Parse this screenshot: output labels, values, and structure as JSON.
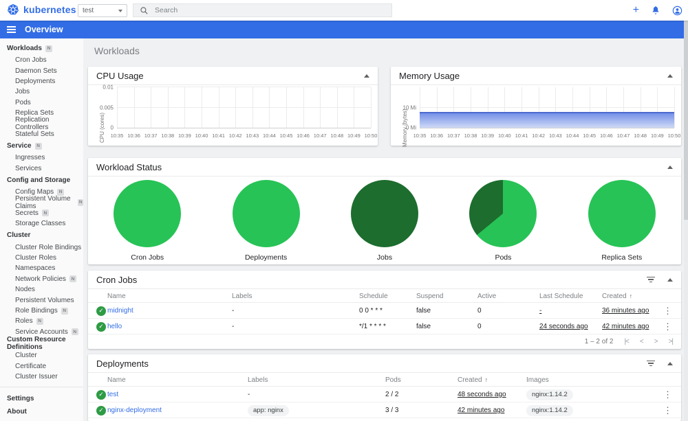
{
  "colors": {
    "accent": "#326de6",
    "pie_green_bright": "#27c356",
    "pie_green_dark": "#1d6d2e",
    "check_green": "#2e9b45",
    "memory_area_line": "#4b69cf"
  },
  "topbar": {
    "brand": "kubernetes",
    "namespace_selected": "test",
    "search_placeholder": "Search",
    "action_icons": [
      "plus-icon",
      "bell-icon",
      "account-icon"
    ]
  },
  "appbar": {
    "title": "Overview"
  },
  "sidebar": {
    "items": [
      {
        "label": "Workloads",
        "type": "group",
        "badge": "N"
      },
      {
        "label": "Cron Jobs",
        "type": "child"
      },
      {
        "label": "Daemon Sets",
        "type": "child"
      },
      {
        "label": "Deployments",
        "type": "child"
      },
      {
        "label": "Jobs",
        "type": "child"
      },
      {
        "label": "Pods",
        "type": "child"
      },
      {
        "label": "Replica Sets",
        "type": "child"
      },
      {
        "label": "Replication Controllers",
        "type": "child"
      },
      {
        "label": "Stateful Sets",
        "type": "child"
      },
      {
        "label": "Service",
        "type": "group",
        "badge": "N"
      },
      {
        "label": "Ingresses",
        "type": "child"
      },
      {
        "label": "Services",
        "type": "child"
      },
      {
        "label": "Config and Storage",
        "type": "section"
      },
      {
        "label": "Config Maps",
        "type": "child",
        "badge": "N"
      },
      {
        "label": "Persistent Volume Claims",
        "type": "child",
        "badge": "N"
      },
      {
        "label": "Secrets",
        "type": "child",
        "badge": "N"
      },
      {
        "label": "Storage Classes",
        "type": "child"
      },
      {
        "label": "Cluster",
        "type": "section"
      },
      {
        "label": "Cluster Role Bindings",
        "type": "child"
      },
      {
        "label": "Cluster Roles",
        "type": "child"
      },
      {
        "label": "Namespaces",
        "type": "child"
      },
      {
        "label": "Network Policies",
        "type": "child",
        "badge": "N"
      },
      {
        "label": "Nodes",
        "type": "child"
      },
      {
        "label": "Persistent Volumes",
        "type": "child"
      },
      {
        "label": "Role Bindings",
        "type": "child",
        "badge": "N"
      },
      {
        "label": "Roles",
        "type": "child",
        "badge": "N"
      },
      {
        "label": "Service Accounts",
        "type": "child",
        "badge": "N"
      },
      {
        "label": "Custom Resource Definitions",
        "type": "section"
      },
      {
        "label": "Cluster",
        "type": "child"
      },
      {
        "label": "Certificate",
        "type": "child"
      },
      {
        "label": "Cluster Issuer",
        "type": "child"
      },
      {
        "type": "divider"
      },
      {
        "label": "Settings",
        "type": "section"
      },
      {
        "label": "About",
        "type": "section"
      }
    ]
  },
  "page": {
    "title": "Workloads"
  },
  "chart_data": [
    {
      "id": "cpu",
      "type": "line",
      "title": "CPU Usage",
      "ylabel": "CPU (cores)",
      "x": [
        "10:35",
        "10:36",
        "10:37",
        "10:38",
        "10:39",
        "10:40",
        "10:41",
        "10:42",
        "10:43",
        "10:44",
        "10:45",
        "10:46",
        "10:47",
        "10:48",
        "10:49",
        "10:50"
      ],
      "series": [],
      "ylim": [
        0,
        0.01
      ],
      "yticks": [
        {
          "label": "0",
          "value": 0
        },
        {
          "label": "0.005",
          "value": 0.005
        },
        {
          "label": "0.01",
          "value": 0.01
        }
      ],
      "grid": true,
      "legend": false
    },
    {
      "id": "memory",
      "type": "area",
      "title": "Memory Usage",
      "ylabel": "Memory (bytes)",
      "x": [
        "10:35",
        "10:36",
        "10:37",
        "10:38",
        "10:39",
        "10:40",
        "10:41",
        "10:42",
        "10:43",
        "10:44",
        "10:45",
        "10:46",
        "10:47",
        "10:48",
        "10:49",
        "10:50"
      ],
      "series": [
        {
          "name": "memory",
          "values": [
            7.8,
            7.8,
            7.8,
            7.8,
            7.8,
            7.8,
            7.8,
            7.8,
            7.8,
            7.8,
            7.8,
            7.8,
            7.8,
            7.8,
            7.8,
            7.8
          ],
          "unit": "Mi"
        }
      ],
      "ylim": [
        0,
        20.3
      ],
      "yticks": [
        {
          "label": "0 Mi",
          "value": 0
        },
        {
          "label": "10 Mi",
          "value": 10
        }
      ],
      "grid": true,
      "legend": false
    },
    {
      "id": "workload-status",
      "type": "pie",
      "title": "Workload Status",
      "pies": [
        {
          "label": "Cron Jobs",
          "segments": [
            {
              "status": "running",
              "color": "#27c356",
              "pct": 100
            }
          ]
        },
        {
          "label": "Deployments",
          "segments": [
            {
              "status": "running",
              "color": "#27c356",
              "pct": 100
            }
          ]
        },
        {
          "label": "Jobs",
          "segments": [
            {
              "status": "succeeded",
              "color": "#1d6d2e",
              "pct": 100
            }
          ]
        },
        {
          "label": "Pods",
          "segments": [
            {
              "status": "running",
              "color": "#27c356",
              "pct": 64
            },
            {
              "status": "succeeded",
              "color": "#1d6d2e",
              "pct": 36
            }
          ]
        },
        {
          "label": "Replica Sets",
          "segments": [
            {
              "status": "running",
              "color": "#27c356",
              "pct": 100
            }
          ]
        }
      ]
    }
  ],
  "cronjobs": {
    "title": "Cron Jobs",
    "columns": [
      "Name",
      "Labels",
      "Schedule",
      "Suspend",
      "Active",
      "Last Schedule",
      "Created"
    ],
    "sort_column": "Created",
    "rows": [
      {
        "name": "midnight",
        "labels": "-",
        "schedule": "0 0 * * *",
        "suspend": "false",
        "active": "0",
        "last_schedule": "-",
        "created": "36 minutes ago"
      },
      {
        "name": "hello",
        "labels": "-",
        "schedule": "*/1 * * * *",
        "suspend": "false",
        "active": "0",
        "last_schedule": "24 seconds ago",
        "created": "42 minutes ago"
      }
    ],
    "pagination": {
      "range": "1 – 2 of 2",
      "buttons": [
        "first-page",
        "prev-page",
        "next-page",
        "last-page"
      ]
    }
  },
  "deployments": {
    "title": "Deployments",
    "columns": [
      "Name",
      "Labels",
      "Pods",
      "Created",
      "Images"
    ],
    "sort_column": "Created",
    "rows": [
      {
        "name": "test",
        "labels": "-",
        "pods": "2 / 2",
        "created": "48 seconds ago",
        "images": "nginx:1.14.2"
      },
      {
        "name": "nginx-deployment",
        "labels": "app: nginx",
        "pods": "3 / 3",
        "created": "42 minutes ago",
        "images": "nginx:1.14.2"
      }
    ]
  }
}
